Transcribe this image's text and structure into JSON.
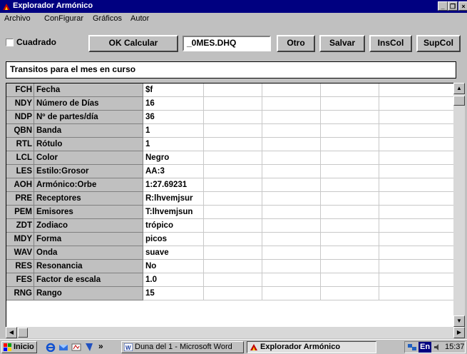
{
  "window": {
    "title": "Explorador Armónico",
    "controls": {
      "minimize": "_",
      "restore": "❐",
      "close": "×"
    }
  },
  "menu": [
    {
      "label": "Archivo"
    },
    {
      "label": "ConFigurar"
    },
    {
      "label": "Gráficos"
    },
    {
      "label": "Autor"
    }
  ],
  "toolbar": {
    "checkbox_label": "Cuadrado",
    "calc_label": "OK Calcular",
    "file_value": "_0MES.DHQ",
    "otro_label": "Otro",
    "salvar_label": "Salvar",
    "inscol_label": "InsCol",
    "supcol_label": "SupCol"
  },
  "status_text": "Transitos para el mes en curso",
  "grid": {
    "rows": [
      {
        "code": "FCH",
        "name": "Fecha",
        "value": "$f"
      },
      {
        "code": "NDY",
        "name": "Número de Días",
        "value": "16"
      },
      {
        "code": "NDP",
        "name": "Nº de partes/día",
        "value": "36"
      },
      {
        "code": "QBN",
        "name": "Banda",
        "value": "1"
      },
      {
        "code": "RTL",
        "name": "Rótulo",
        "value": "1"
      },
      {
        "code": "LCL",
        "name": "Color",
        "value": "Negro"
      },
      {
        "code": "LES",
        "name": "Estilo:Grosor",
        "value": "AA:3"
      },
      {
        "code": "AOH",
        "name": "Armónico:Orbe",
        "value": "1:27.69231"
      },
      {
        "code": "PRE",
        "name": "Receptores",
        "value": "R:lhvemjsur"
      },
      {
        "code": "PEM",
        "name": "Emisores",
        "value": "T:lhvemjsun"
      },
      {
        "code": "ZDT",
        "name": "Zodiaco",
        "value": "trópico"
      },
      {
        "code": "MDY",
        "name": "Forma",
        "value": "picos"
      },
      {
        "code": "WAV",
        "name": "Onda",
        "value": "suave"
      },
      {
        "code": "RES",
        "name": "Resonancia",
        "value": "No"
      },
      {
        "code": "FES",
        "name": "Factor de escala",
        "value": "1.0"
      },
      {
        "code": "RNG",
        "name": "Rango",
        "value": "15"
      }
    ]
  },
  "taskbar": {
    "start_label": "Inicio",
    "chevron": "»",
    "tasks": [
      {
        "label": "Duna del 1 - Microsoft Word"
      },
      {
        "label": "Explorador Armónico"
      }
    ],
    "tray_lang": "En",
    "clock": "15:37"
  },
  "colors": {
    "titlebar": "#000080",
    "face": "#c0c0c0",
    "grid_bg": "#ffffff"
  }
}
